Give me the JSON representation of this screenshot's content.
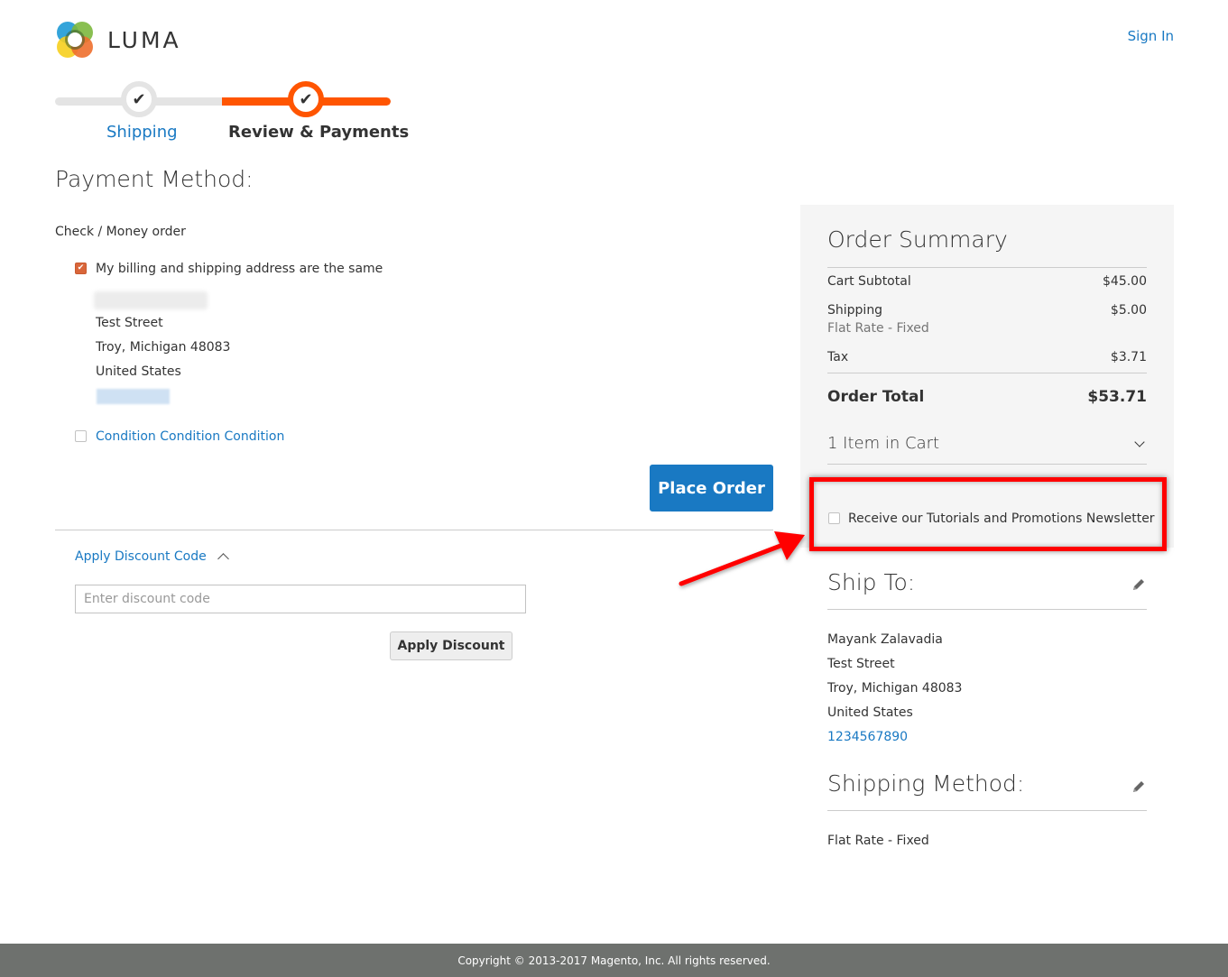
{
  "header": {
    "logo_text": "LUMA",
    "sign_in_label": "Sign In"
  },
  "progress": {
    "steps": [
      {
        "label": "Shipping",
        "state": "complete"
      },
      {
        "label": "Review & Payments",
        "state": "active"
      }
    ],
    "current_step": 2,
    "total_steps": 2,
    "accent_color": "#ff5501"
  },
  "payment": {
    "title": "Payment Method:",
    "method_label": "Check / Money order",
    "billing_same_label": "My billing and shipping address are the same",
    "billing_same_checked": true,
    "billing_address": {
      "name": "[blurred]",
      "street": "Test Street",
      "city_line": "Troy, Michigan 48083",
      "country": "United States",
      "phone": "[blurred]"
    },
    "condition_label": "Condition Condition Condition",
    "condition_checked": false,
    "place_order_label": "Place Order"
  },
  "discount": {
    "toggle_label": "Apply Discount Code",
    "input_placeholder": "Enter discount code",
    "input_value": "",
    "apply_label": "Apply Discount"
  },
  "summary": {
    "title": "Order Summary",
    "rows": [
      {
        "label": "Cart Subtotal",
        "value": "$45.00"
      },
      {
        "label": "Shipping",
        "sublabel": "Flat Rate - Fixed",
        "value": "$5.00"
      },
      {
        "label": "Tax",
        "value": "$3.71"
      }
    ],
    "total_label": "Order Total",
    "total_value": "$53.71",
    "items_in_cart": "1 Item in Cart",
    "newsletter_label": "Receive our Tutorials and Promotions Newsletter",
    "newsletter_checked": false
  },
  "ship_to": {
    "title": "Ship To:",
    "name": "Mayank Zalavadia",
    "street": "Test Street",
    "city_line": "Troy, Michigan 48083",
    "country": "United States",
    "phone": "1234567890"
  },
  "shipping_method": {
    "title": "Shipping Method:",
    "value": "Flat Rate - Fixed"
  },
  "annotation": {
    "highlight_color": "#ff0000"
  },
  "footer": {
    "copyright": "Copyright © 2013-2017 Magento, Inc. All rights reserved."
  }
}
